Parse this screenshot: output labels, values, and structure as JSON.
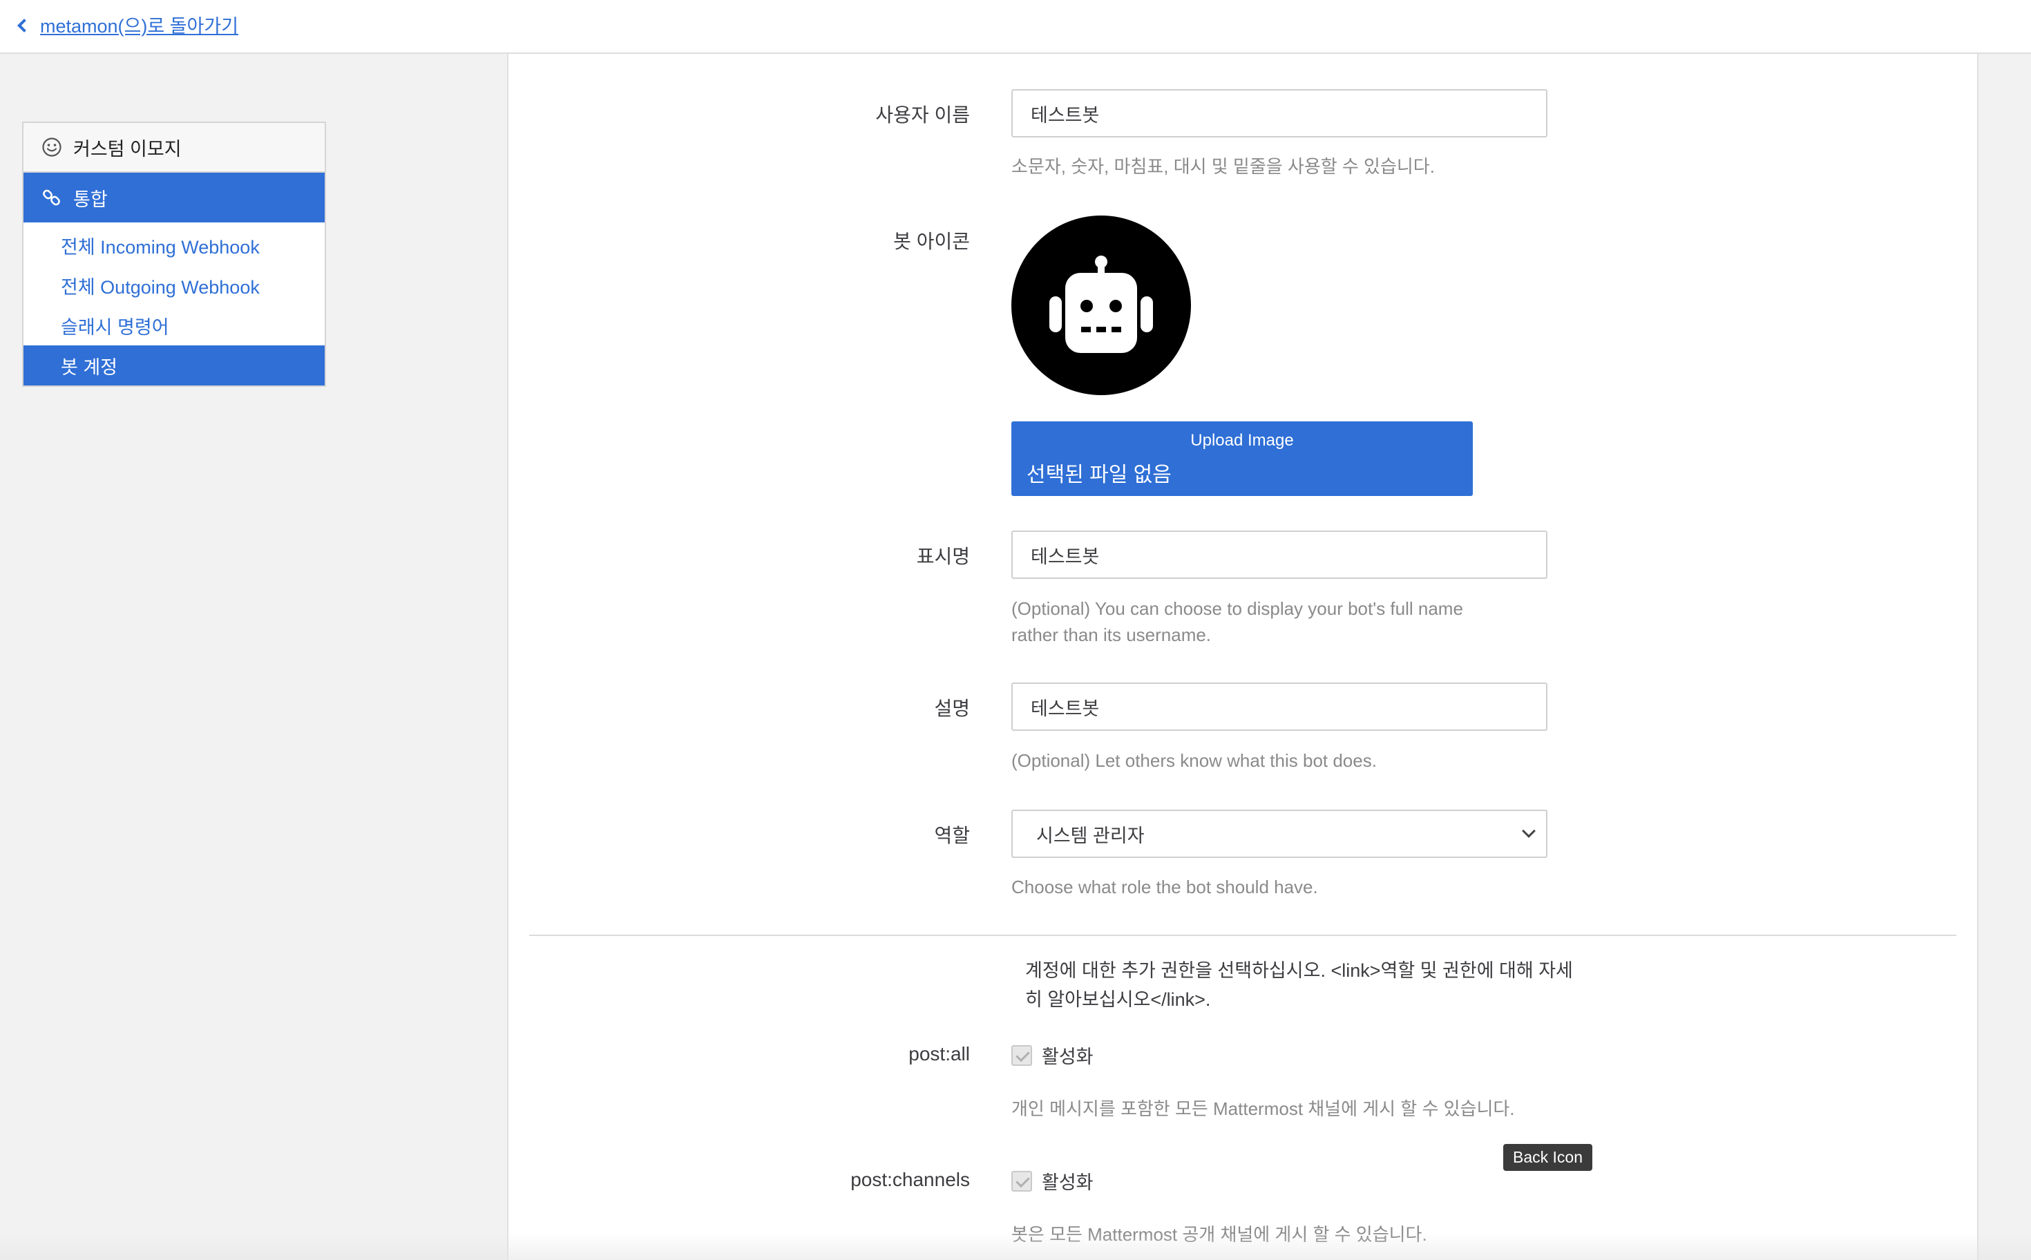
{
  "topbar": {
    "back_label": "metamon(으)로 돌아가기"
  },
  "sidebar": {
    "header": "커스텀 이모지",
    "section": "통합",
    "items": [
      {
        "label": "전체 Incoming Webhook"
      },
      {
        "label": "전체 Outgoing Webhook"
      },
      {
        "label": "슬래시 명령어"
      },
      {
        "label": "봇 계정",
        "active": true
      }
    ]
  },
  "form": {
    "username": {
      "label": "사용자 이름",
      "value": "테스트봇",
      "help": "소문자, 숫자, 마침표, 대시 및 밑줄을 사용할 수 있습니다."
    },
    "icon": {
      "label": "봇 아이콘",
      "upload_label": "Upload Image",
      "file_status": "선택된 파일 없음"
    },
    "display_name": {
      "label": "표시명",
      "value": "테스트봇",
      "help_line1": "(Optional) You can choose to display your bot's full name",
      "help_line2": "rather than its username."
    },
    "description": {
      "label": "설명",
      "value": "테스트봇",
      "help": "(Optional) Let others know what this bot does."
    },
    "role": {
      "label": "역할",
      "selected": "시스템 관리자",
      "help": "Choose what role the bot should have."
    },
    "permissions": {
      "intro_line1": "계정에 대한 추가 권한을 선택하십시오. <link>역할 및 권한에 대해 자세",
      "intro_line2": "히 알아보십시오</link>.",
      "post_all": {
        "label": "post:all",
        "checkbox_label": "활성화",
        "help": "개인 메시지를 포함한 모든 Mattermost 채널에 게시 할 수 있습니다."
      },
      "post_channels": {
        "label": "post:channels",
        "checkbox_label": "활성화",
        "help": "봇은 모든 Mattermost 공개 채널에 게시 할 수 있습니다."
      }
    }
  },
  "tooltip": "Back Icon",
  "colors": {
    "accent": "#2f6fd6",
    "background": "#f2f2f2",
    "panel": "#ffffff"
  }
}
